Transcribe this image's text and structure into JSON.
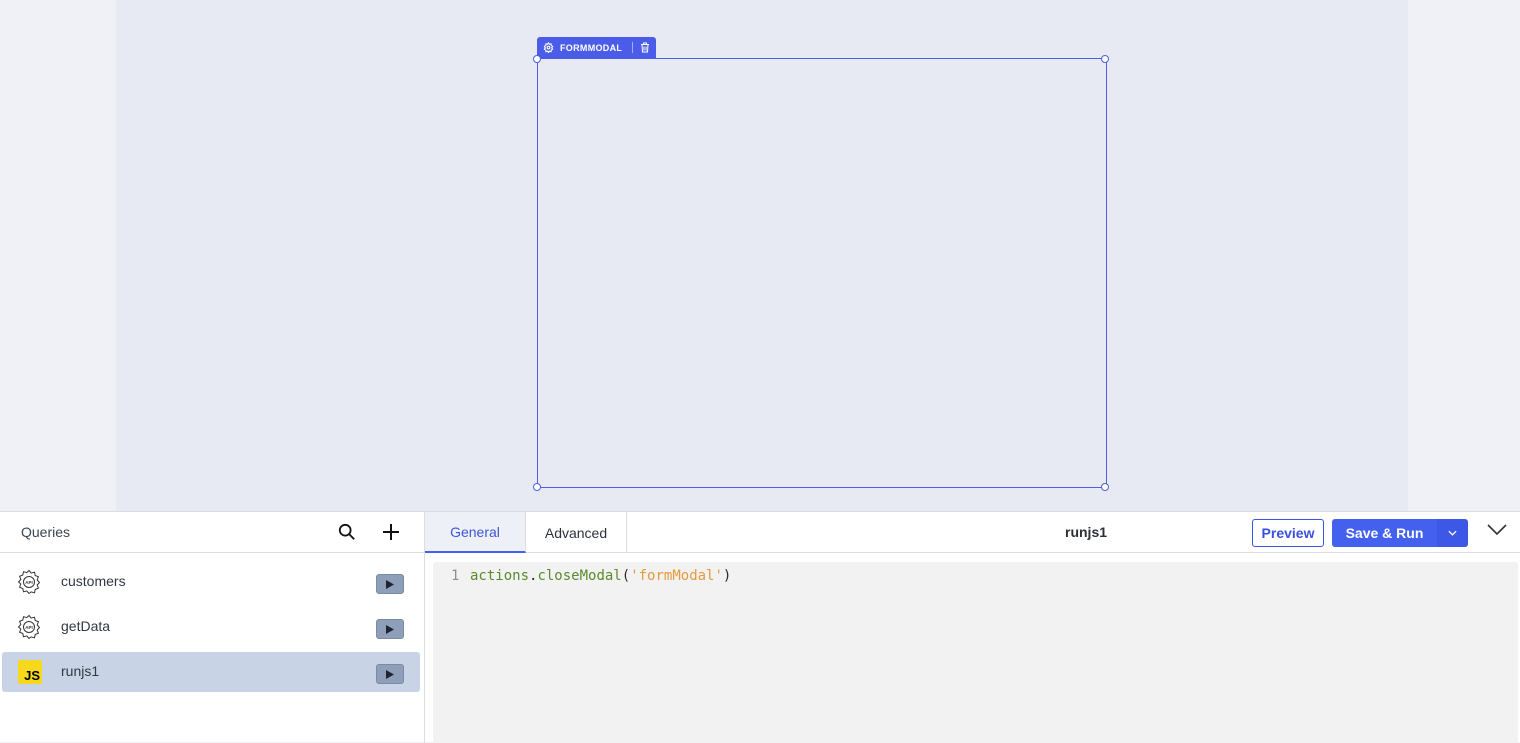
{
  "canvas": {
    "widget": {
      "name": "FORMMODAL",
      "settings_icon": "gear-icon",
      "delete_icon": "trash-icon"
    }
  },
  "queries": {
    "title": "Queries",
    "search_icon": "search-icon",
    "add_icon": "plus-icon",
    "items": [
      {
        "label": "customers",
        "type": "restapi",
        "icon": "api-gear-icon",
        "active": false
      },
      {
        "label": "getData",
        "type": "restapi",
        "icon": "api-gear-icon",
        "active": false
      },
      {
        "label": "runjs1",
        "type": "runjs",
        "icon": "js-icon",
        "icon_text": "JS",
        "active": true
      }
    ]
  },
  "editor": {
    "tabs": [
      {
        "label": "General",
        "active": true
      },
      {
        "label": "Advanced",
        "active": false
      }
    ],
    "query_name": "runjs1",
    "preview_label": "Preview",
    "save_run_label": "Save & Run",
    "code": {
      "line_number": "1",
      "tokens": {
        "obj": "actions",
        "dot": ".",
        "fn": "closeModal",
        "open": "(",
        "arg": "'formModal'",
        "close": ")"
      }
    }
  },
  "colors": {
    "accent": "#4361ee",
    "selection": "#4d5fe8",
    "active_item_bg": "#c8d4e5",
    "js_badge": "#f6d91c",
    "string": "#e59a3c",
    "identifier": "#5a8a2c"
  }
}
